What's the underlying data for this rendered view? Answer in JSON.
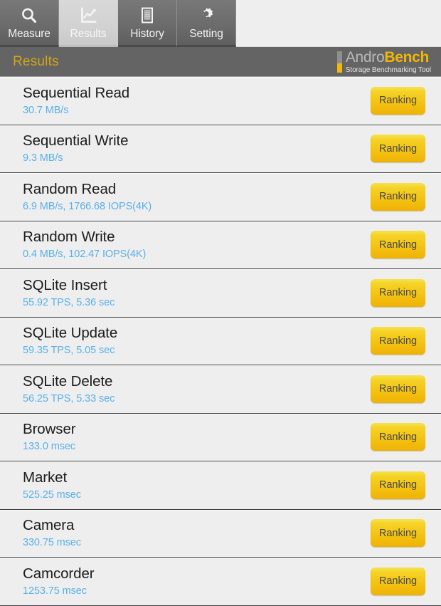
{
  "tabs": [
    {
      "label": "Measure",
      "icon": "search-icon",
      "active": false
    },
    {
      "label": "Results",
      "icon": "chart-line-icon",
      "active": true
    },
    {
      "label": "History",
      "icon": "document-lines-icon",
      "active": false
    },
    {
      "label": "Setting",
      "icon": "gear-icon",
      "active": false
    }
  ],
  "header": {
    "title": "Results",
    "logo_main_1": "Andro",
    "logo_main_2": "Bench",
    "logo_sub": "Storage Benchmarking Tool"
  },
  "colors": {
    "accent_yellow": "#f2b705",
    "title_gold": "#d4a616",
    "value_blue": "#5ab0e8",
    "header_gray": "#646464",
    "list_bg": "#eeeeee"
  },
  "ranking_button_label": "Ranking",
  "results": [
    {
      "title": "Sequential Read",
      "value": "30.7 MB/s",
      "button": "Ranking"
    },
    {
      "title": "Sequential Write",
      "value": "9.3 MB/s",
      "button": "Ranking"
    },
    {
      "title": "Random Read",
      "value": "6.9 MB/s, 1766.68 IOPS(4K)",
      "button": "Ranking"
    },
    {
      "title": "Random Write",
      "value": "0.4 MB/s, 102.47 IOPS(4K)",
      "button": "Ranking"
    },
    {
      "title": "SQLite Insert",
      "value": "55.92 TPS, 5.36 sec",
      "button": "Ranking"
    },
    {
      "title": "SQLite Update",
      "value": "59.35 TPS, 5.05 sec",
      "button": "Ranking"
    },
    {
      "title": "SQLite Delete",
      "value": "56.25 TPS, 5.33 sec",
      "button": "Ranking"
    },
    {
      "title": "Browser",
      "value": "133.0 msec",
      "button": "Ranking"
    },
    {
      "title": "Market",
      "value": "525.25 msec",
      "button": "Ranking"
    },
    {
      "title": "Camera",
      "value": "330.75 msec",
      "button": "Ranking"
    },
    {
      "title": "Camcorder",
      "value": "1253.75 msec",
      "button": "Ranking"
    }
  ]
}
